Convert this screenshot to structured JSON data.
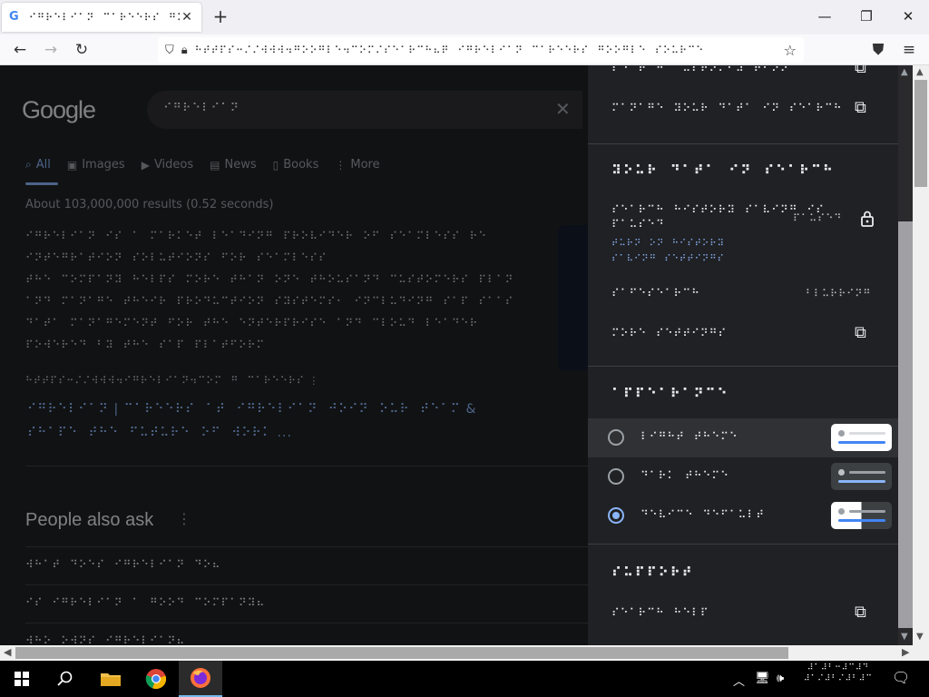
{
  "browser": {
    "tab_title": "⠊⠛⠗⠑⠇⠊⠁⠝⠀⠉⠁⠗⠑⠑⠗⠎⠀⠛⠕⠕⠛⠇⠑",
    "tab_close": "✕",
    "new_tab": "+",
    "url": "⠓⠞⠞⠏⠎⠒⠌⠌⠺⠺⠺⠲⠛⠕⠕⠛⠇⠑⠲⠉⠕⠍⠌⠎⠑⠁⠗⠉⠓⠦⠟⠀⠊⠛⠗⠑⠇⠊⠁⠝⠀⠉⠁⠗⠑⠑⠗⠎⠀⠛⠕⠕⠛⠇⠑⠀⠎⠕⠥⠗⠉⠑",
    "window_controls": [
      "—",
      "❐",
      "✕"
    ]
  },
  "google": {
    "logo": "Google",
    "query": "⠊⠛⠗⠑⠇⠊⠁⠝",
    "clear": "✕",
    "tabs": [
      {
        "label": "All",
        "icon": "⌕"
      },
      {
        "label": "Images",
        "icon": "▣"
      },
      {
        "label": "Videos",
        "icon": "▶"
      },
      {
        "label": "News",
        "icon": "▤"
      },
      {
        "label": "Books",
        "icon": "▯"
      },
      {
        "label": "More",
        "icon": "⋮"
      }
    ],
    "result_stats": "About 103,000,000 results (0.52 seconds)",
    "snippet_lines": [
      "⠊⠛⠗⠑⠇⠊⠁⠝⠀⠊⠎⠀⠁⠀⠍⠁⠗⠅⠑⠞⠀⠇⠑⠁⠙⠊⠝⠛⠀⠏⠗⠕⠧⠊⠙⠑⠗⠀⠕⠋⠀⠎⠑⠁⠍⠇⠑⠎⠎⠀⠗⠑",
      "⠊⠝⠞⠑⠛⠗⠁⠞⠊⠕⠝⠀⠎⠕⠇⠥⠞⠊⠕⠝⠎⠀⠋⠕⠗⠀⠎⠑⠁⠍⠇⠑⠎⠎",
      "⠞⠓⠑⠀⠉⠕⠍⠏⠁⠝⠽⠀⠓⠑⠇⠏⠎⠀⠍⠕⠗⠑⠀⠞⠓⠁⠝⠀⠕⠝⠑⠀⠞⠓⠕⠥⠎⠁⠝⠙⠀⠉⠥⠎⠞⠕⠍⠑⠗⠎⠀⠏⠇⠁⠝",
      "⠁⠝⠙⠀⠍⠁⠝⠁⠛⠑⠀⠞⠓⠑⠊⠗⠀⠏⠗⠕⠙⠥⠉⠞⠊⠕⠝⠀⠎⠽⠎⠞⠑⠍⠎⠂⠀⠊⠝⠉⠇⠥⠙⠊⠝⠛⠀⠎⠁⠏⠀⠎⠁⠁⠎",
      "⠙⠁⠞⠁⠀⠍⠁⠝⠁⠛⠑⠍⠑⠝⠞⠀⠋⠕⠗⠀⠞⠓⠑⠀⠑⠝⠞⠑⠗⠏⠗⠊⠎⠑⠀⠁⠝⠙⠀⠉⠇⠕⠥⠙⠀⠇⠑⠁⠙⠑⠗",
      "⠏⠕⠺⠑⠗⠑⠙⠀⠃⠽⠀⠞⠓⠑⠀⠎⠁⠏⠀⠏⠇⠁⠞⠋⠕⠗⠍"
    ],
    "cite": "⠓⠞⠞⠏⠎⠒⠌⠌⠺⠺⠺⠲⠊⠛⠗⠑⠇⠊⠁⠝⠲⠉⠕⠍⠀⠛⠀⠉⠁⠗⠑⠑⠗⠎  ⋮",
    "result_title_1": "⠊⠛⠗⠑⠇⠊⠁⠝  |  ⠉⠁⠗⠑⠑⠗⠎⠀⠁⠞⠀⠊⠛⠗⠑⠇⠊⠁⠝⠀⠚⠕⠊⠝⠀⠕⠥⠗⠀⠞⠑⠁⠍  &",
    "result_title_2": "⠎⠓⠁⠏⠑⠀⠞⠓⠑⠀⠋⠥⠞⠥⠗⠑⠀⠕⠋⠀⠺⠕⠗⠅ ...",
    "paa_title": "People also ask",
    "paa_items": [
      "⠺⠓⠁⠞⠀⠙⠕⠑⠎⠀⠊⠛⠗⠑⠇⠊⠁⠝⠀⠙⠕⠦",
      "⠊⠎⠀⠊⠛⠗⠑⠇⠊⠁⠝⠀⠁⠀⠛⠕⠕⠙⠀⠉⠕⠍⠏⠁⠝⠽⠦",
      "⠺⠓⠕⠀⠕⠺⠝⠎⠀⠊⠛⠗⠑⠇⠊⠁⠝⠦"
    ]
  },
  "panel": {
    "top_row_1": "⠎⠑⠁⠗⠉⠓⠀⠉⠥⠎⠞⠕⠍⠊⠵⠁⠞⠊⠕⠝",
    "top_row_2": "⠍⠁⠝⠁⠛⠑⠀⠽⠕⠥⠗⠀⠙⠁⠞⠁⠀⠊⠝⠀⠎⠑⠁⠗⠉⠓",
    "your_data_title": "⠽⠕⠥⠗⠀⠙⠁⠞⠁⠀⠊⠝⠀⠎⠑⠁⠗⠉⠓",
    "history_line_1": "⠎⠑⠁⠗⠉⠓⠀⠓⠊⠎⠞⠕⠗⠽⠀⠎⠁⠧⠊⠝⠛⠀⠊⠎",
    "history_line_2": "⠏⠁⠥⠎⠑⠙",
    "history_link_1": "⠞⠥⠗⠝⠀⠕⠝⠀⠓⠊⠎⠞⠕⠗⠽",
    "history_link_2": "⠎⠁⠧⠊⠝⠛⠀⠎⠑⠞⠞⠊⠝⠛⠎",
    "history_status": "⠏⠁⠥⠎⠑⠙",
    "safesearch_label": "⠎⠁⠋⠑⠎⠑⠁⠗⠉⠓",
    "safesearch_value": "⠃⠇⠥⠗⠗⠊⠝⠛",
    "more_settings": "⠍⠕⠗⠑⠀⠎⠑⠞⠞⠊⠝⠛⠎",
    "appearance_title": "⠁⠏⠏⠑⠁⠗⠁⠝⠉⠑",
    "themes": [
      {
        "label": "⠇⠊⠛⠓⠞⠀⠞⠓⠑⠍⠑",
        "selected": false,
        "preview": "light"
      },
      {
        "label": "⠙⠁⠗⠅⠀⠞⠓⠑⠍⠑",
        "selected": false,
        "preview": "dark"
      },
      {
        "label": "⠙⠑⠧⠊⠉⠑⠀⠙⠑⠋⠁⠥⠇⠞",
        "selected": true,
        "preview": "split"
      }
    ],
    "support_title": "⠎⠥⠏⠏⠕⠗⠞",
    "support_row": "⠎⠑⠁⠗⠉⠓⠀⠓⠑⠇⠏"
  },
  "taskbar": {
    "clock_line_1": "⠼⠁⠼⠃⠒⠼⠉⠼⠙",
    "clock_line_2": "⠼⠁⠌⠼⠃⠌⠼⠃⠼⠉"
  },
  "colors": {
    "page_bg": "#202124",
    "accent": "#8ab4f8",
    "text": "#e8eaed",
    "muted": "#9aa0a6"
  }
}
